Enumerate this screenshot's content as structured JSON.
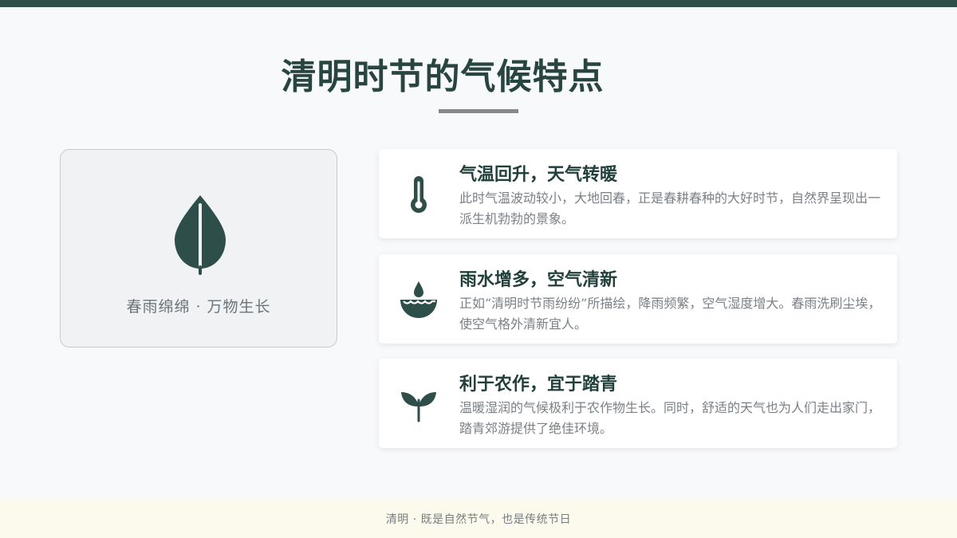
{
  "slide": {
    "title": "清明时节的气候特点",
    "image_caption": "春雨绵绵 · 万物生长",
    "features": [
      {
        "title": "气温回升，天气转暖",
        "description": "此时气温波动较小，大地回春，正是春耕春种的大好时节，自然界呈现出一派生机勃勃的景象。",
        "icon": "thermometer-icon"
      },
      {
        "title": "雨水增多，空气清新",
        "description": "正如“清明时节雨纷纷”所描绘，降雨频繁，空气湿度增大。春雨洗刷尘埃，使空气格外清新宜人。",
        "icon": "water-drop-icon"
      },
      {
        "title": "利于农作，宜于踏青",
        "description": "温暖湿润的气候极利于农作物生长。同时，舒适的天气也为人们走出家门，踏青郊游提供了绝佳环境。",
        "icon": "sprout-icon"
      }
    ],
    "footer_text": "清明 · 既是自然节气，也是传统节日",
    "colors": {
      "accent": "#2e4e4a",
      "title": "#28453f",
      "body_text": "#7a8085",
      "footer_bg": "#fbfaec"
    }
  }
}
